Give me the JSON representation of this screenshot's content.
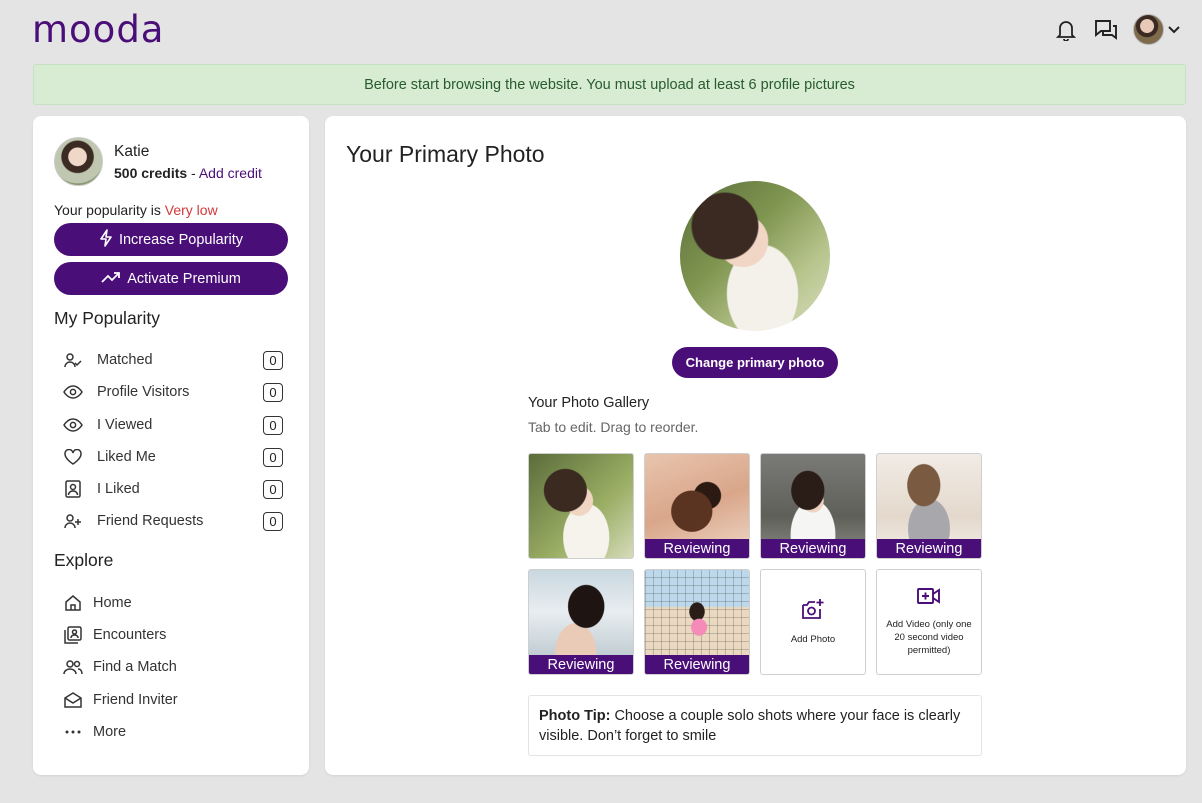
{
  "header": {
    "logo": "mooda",
    "icons": [
      "bell-icon",
      "chat-icon",
      "chevron-down-icon"
    ]
  },
  "banner": {
    "text": "Before start browsing the website. You must upload at least 6 profile pictures"
  },
  "sidebar": {
    "user": {
      "name": "Katie",
      "credits": "500 credits",
      "separator": " - ",
      "add_credit": "Add credit"
    },
    "popularity_prefix": "Your popularity is ",
    "popularity_value": "Very low",
    "increase_btn": "Increase Popularity",
    "premium_btn": "Activate Premium",
    "my_popularity_title": "My Popularity",
    "popularity_items": [
      {
        "label": "Matched",
        "count": "0",
        "icon": "user-check-icon"
      },
      {
        "label": "Profile Visitors",
        "count": "0",
        "icon": "eye-icon"
      },
      {
        "label": "I Viewed",
        "count": "0",
        "icon": "eye-icon"
      },
      {
        "label": "Liked Me",
        "count": "0",
        "icon": "heart-icon"
      },
      {
        "label": "I Liked",
        "count": "0",
        "icon": "portrait-icon"
      },
      {
        "label": "Friend Requests",
        "count": "0",
        "icon": "user-plus-icon"
      }
    ],
    "explore_title": "Explore",
    "explore_items": [
      {
        "label": "Home",
        "icon": "home-icon"
      },
      {
        "label": "Encounters",
        "icon": "encounters-icon"
      },
      {
        "label": "Find a Match",
        "icon": "users-icon"
      },
      {
        "label": "Friend Inviter",
        "icon": "envelope-icon"
      },
      {
        "label": "More",
        "icon": "more-icon"
      }
    ]
  },
  "main": {
    "title": "Your Primary Photo",
    "change_btn": "Change primary photo",
    "gallery_title": "Your Photo Gallery",
    "gallery_sub": "Tab to edit. Drag to reorder.",
    "photos": [
      {
        "status": ""
      },
      {
        "status": "Reviewing"
      },
      {
        "status": "Reviewing"
      },
      {
        "status": "Reviewing"
      },
      {
        "status": "Reviewing"
      },
      {
        "status": "Reviewing"
      }
    ],
    "add_photo": "Add Photo",
    "add_video": "Add Video (only one 20 second video permitted)",
    "tip_label": "Photo Tip:",
    "tip_text": " Choose a couple solo shots where your face is clearly visible. Don’t forget to smile"
  },
  "colors": {
    "brand": "#4a0e78",
    "banner_bg": "#d7ecd3",
    "banner_text": "#285c2c",
    "warning": "#d13a3a"
  }
}
